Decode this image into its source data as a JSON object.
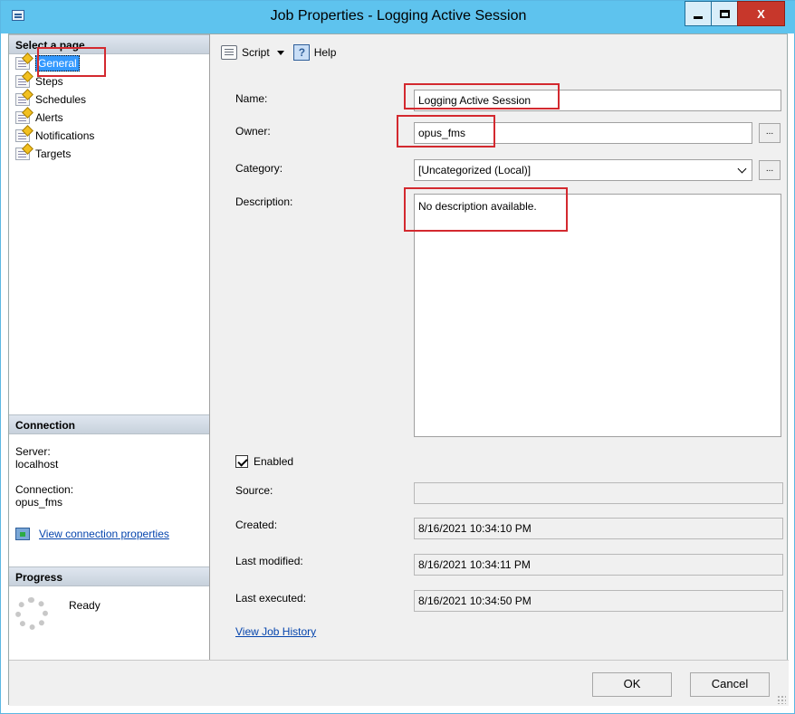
{
  "window": {
    "title": "Job Properties - Logging Active Session"
  },
  "left_panel": {
    "select_page_header": "Select a page",
    "pages": [
      {
        "label": "General",
        "selected": true
      },
      {
        "label": "Steps",
        "selected": false
      },
      {
        "label": "Schedules",
        "selected": false
      },
      {
        "label": "Alerts",
        "selected": false
      },
      {
        "label": "Notifications",
        "selected": false
      },
      {
        "label": "Targets",
        "selected": false
      }
    ],
    "connection_header": "Connection",
    "server_label": "Server:",
    "server_value": "localhost",
    "connection_label": "Connection:",
    "connection_value": "opus_fms",
    "view_connection_properties": "View connection properties",
    "progress_header": "Progress",
    "progress_status": "Ready"
  },
  "toolbar": {
    "script_label": "Script",
    "help_label": "Help"
  },
  "form": {
    "name_label": "Name:",
    "name_value": "Logging Active Session",
    "owner_label": "Owner:",
    "owner_value": "opus_fms",
    "owner_button": "...",
    "category_label": "Category:",
    "category_value": "[Uncategorized (Local)]",
    "category_button": "...",
    "description_label": "Description:",
    "description_value": "No description available.",
    "enabled_label": "Enabled",
    "enabled_checked": true,
    "source_label": "Source:",
    "source_value": "",
    "created_label": "Created:",
    "created_value": "8/16/2021 10:34:10 PM",
    "last_modified_label": "Last modified:",
    "last_modified_value": "8/16/2021 10:34:11 PM",
    "last_executed_label": "Last executed:",
    "last_executed_value": "8/16/2021 10:34:50 PM",
    "view_job_history": "View Job History"
  },
  "buttons": {
    "ok": "OK",
    "cancel": "Cancel"
  },
  "colors": {
    "title_bar": "#5ec3ee",
    "selected_item": "#3399ff",
    "highlight_boxes": "#d3292f"
  }
}
